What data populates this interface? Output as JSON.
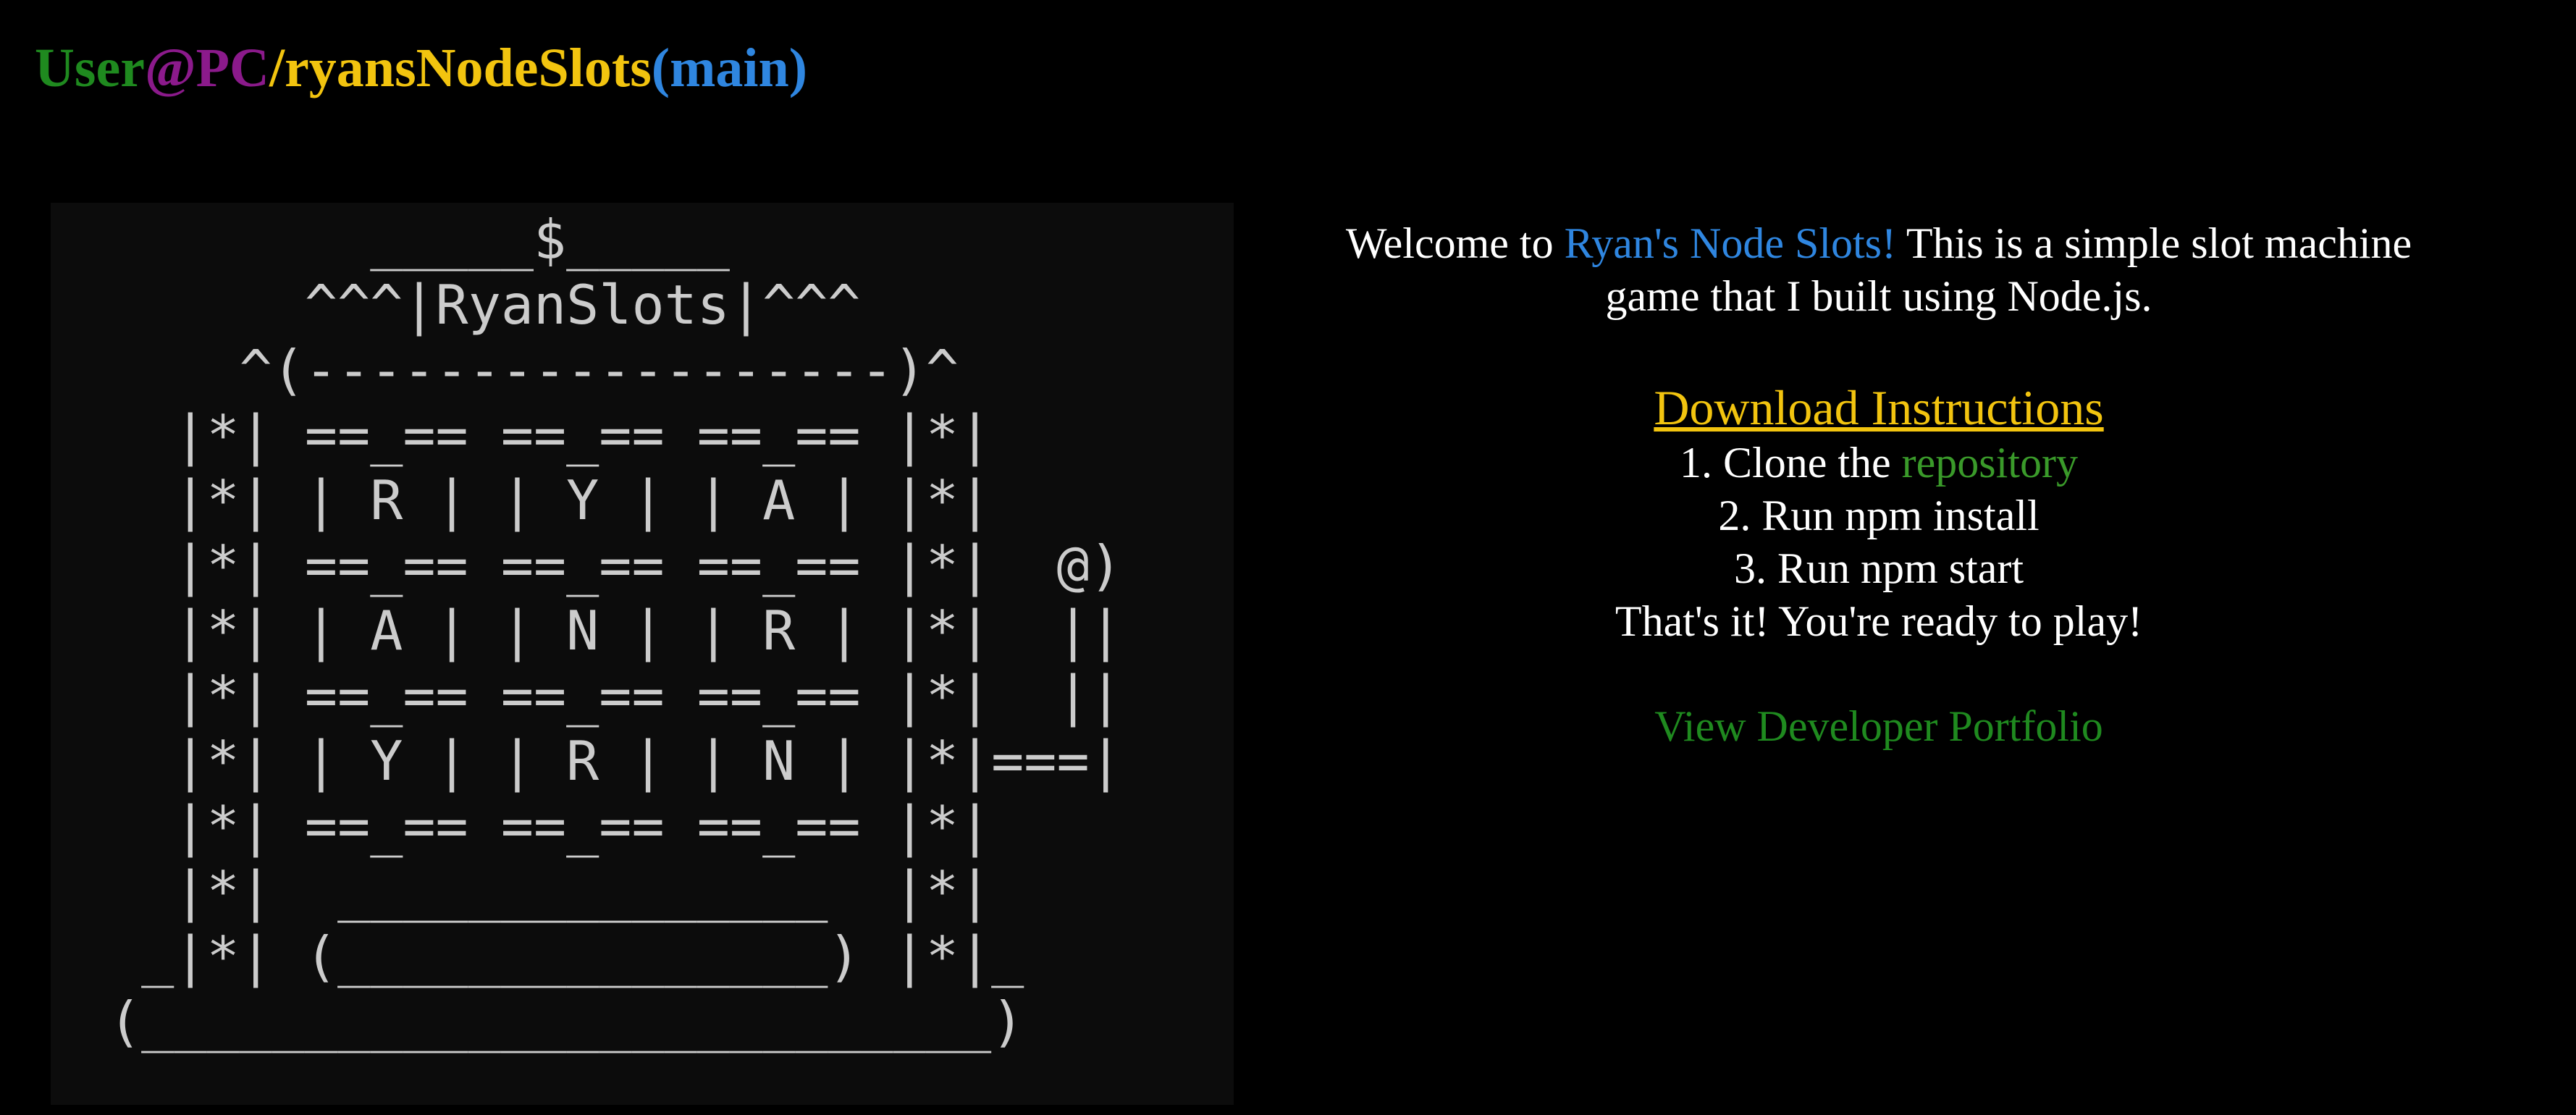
{
  "prompt": {
    "user": "User",
    "host": "@PC",
    "path": "/ryansNodeSlots",
    "branch": "(main)"
  },
  "ascii_art": {
    "lines": [
      "     _____$_____",
      "   ^^^|RyanSlots|^^^",
      " ^(------------------)^",
      "|*| ==_== ==_== ==_== |*|",
      "|*| | R | | Y | | A | |*|",
      "|*| ==_== ==_== ==_== |*|  @)",
      "|*| | A | | N | | R | |*|  ||",
      "|*| ==_== ==_== ==_== |*|  ||",
      "|*| | Y | | R | | N | |*|===|",
      "|*| ==_== ==_== ==_== |*|",
      "|*|  _______________  |*|",
      "_|*| (_______________) |*|_",
      "(__________________________)"
    ]
  },
  "welcome": {
    "prefix": "Welcome to ",
    "app_name": "Ryan's Node Slots!",
    "suffix_line1": " This is a simple slot machine",
    "line2": "game that I built using Node.js."
  },
  "download": {
    "heading": "Download Instructions",
    "step1_prefix": "1. Clone the ",
    "step1_link": "repository",
    "step2": "2. Run npm install",
    "step3": "3. Run npm start",
    "closing": "That's it! You're ready to play!"
  },
  "portfolio_link": "View Developer Portfolio",
  "colors": {
    "user": "#1f8a1f",
    "host": "#8b1a8b",
    "path": "#f2c40f",
    "branch": "#2f86e0",
    "app_name": "#2f86e0",
    "heading": "#f2c40f",
    "repo_link": "#3a9a2a",
    "portfolio_link": "#1f8a1f",
    "ascii": "#cccccc",
    "panel": "#0c0c0c",
    "background": "#000000"
  }
}
